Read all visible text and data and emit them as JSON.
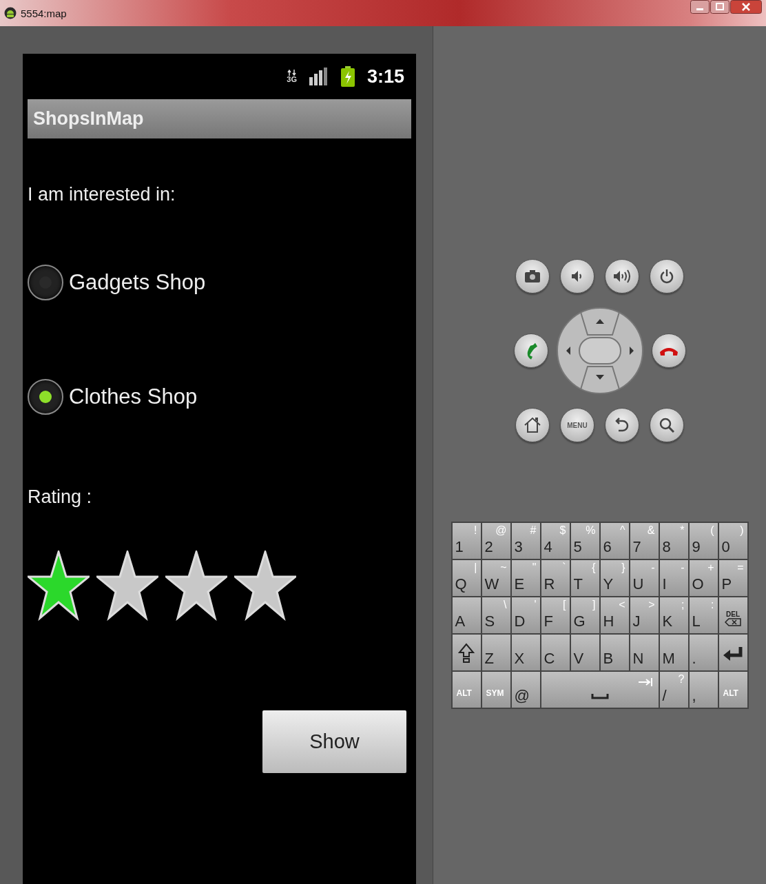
{
  "window": {
    "title": "5554:map"
  },
  "phone": {
    "status_bar": {
      "network": "3G",
      "time": "3:15"
    },
    "app_title": "ShopsInMap",
    "prompt": "I am interested in:",
    "options": [
      {
        "label": "Gadgets Shop",
        "selected": false
      },
      {
        "label": "Clothes Shop",
        "selected": true
      }
    ],
    "rating": {
      "label": "Rating :",
      "stars": 1
    },
    "button": "Show"
  },
  "controls": {
    "top": [
      {
        "kind": "camera"
      },
      {
        "kind": "volume-down"
      },
      {
        "kind": "volume-up"
      },
      {
        "kind": "power"
      }
    ],
    "middle": [
      {
        "kind": "call"
      },
      {
        "kind": "dpad"
      },
      {
        "kind": "end-call"
      }
    ],
    "bottom": [
      {
        "kind": "home"
      },
      {
        "kind": "menu",
        "label": "MENU"
      },
      {
        "kind": "back"
      },
      {
        "kind": "search"
      }
    ]
  },
  "keyboard": [
    [
      {
        "kind": "char",
        "main": "1",
        "alt": "!"
      },
      {
        "kind": "char",
        "main": "2",
        "alt": "@"
      },
      {
        "kind": "char",
        "main": "3",
        "alt": "#"
      },
      {
        "kind": "char",
        "main": "4",
        "alt": "$"
      },
      {
        "kind": "char",
        "main": "5",
        "alt": "%"
      },
      {
        "kind": "char",
        "main": "6",
        "alt": "^"
      },
      {
        "kind": "char",
        "main": "7",
        "alt": "&"
      },
      {
        "kind": "char",
        "main": "8",
        "alt": "*"
      },
      {
        "kind": "char",
        "main": "9",
        "alt": "("
      },
      {
        "kind": "char",
        "main": "0",
        "alt": ")"
      }
    ],
    [
      {
        "kind": "char",
        "main": "Q",
        "alt": "|"
      },
      {
        "kind": "char",
        "main": "W",
        "alt": "~"
      },
      {
        "kind": "char",
        "main": "E",
        "alt": "\""
      },
      {
        "kind": "char",
        "main": "R",
        "alt": "`"
      },
      {
        "kind": "char",
        "main": "T",
        "alt": "{"
      },
      {
        "kind": "char",
        "main": "Y",
        "alt": "}"
      },
      {
        "kind": "char",
        "main": "U",
        "alt": "-"
      },
      {
        "kind": "char",
        "main": "I",
        "alt": "-"
      },
      {
        "kind": "char",
        "main": "O",
        "alt": "+"
      },
      {
        "kind": "char",
        "main": "P",
        "alt": "="
      }
    ],
    [
      {
        "kind": "char",
        "main": "A"
      },
      {
        "kind": "char",
        "main": "S",
        "alt": "\\"
      },
      {
        "kind": "char",
        "main": "D",
        "alt": "'"
      },
      {
        "kind": "char",
        "main": "F",
        "alt": "["
      },
      {
        "kind": "char",
        "main": "G",
        "alt": "]"
      },
      {
        "kind": "char",
        "main": "H",
        "alt": "<"
      },
      {
        "kind": "char",
        "main": "J",
        "alt": ">"
      },
      {
        "kind": "char",
        "main": "K",
        "alt": ";"
      },
      {
        "kind": "char",
        "main": "L",
        "alt": ":"
      },
      {
        "kind": "del",
        "main": "DEL"
      }
    ],
    [
      {
        "kind": "shift"
      },
      {
        "kind": "char",
        "main": "Z"
      },
      {
        "kind": "char",
        "main": "X"
      },
      {
        "kind": "char",
        "main": "C"
      },
      {
        "kind": "char",
        "main": "V"
      },
      {
        "kind": "char",
        "main": "B"
      },
      {
        "kind": "char",
        "main": "N"
      },
      {
        "kind": "char",
        "main": "M"
      },
      {
        "kind": "char",
        "main": "."
      },
      {
        "kind": "enter"
      }
    ],
    [
      {
        "kind": "mod",
        "main": "ALT"
      },
      {
        "kind": "mod",
        "main": "SYM"
      },
      {
        "kind": "char",
        "main": "@"
      },
      {
        "kind": "space"
      },
      {
        "kind": "char",
        "main": "/",
        "alt": "?"
      },
      {
        "kind": "char",
        "main": ","
      },
      {
        "kind": "mod",
        "main": "ALT"
      }
    ]
  ]
}
